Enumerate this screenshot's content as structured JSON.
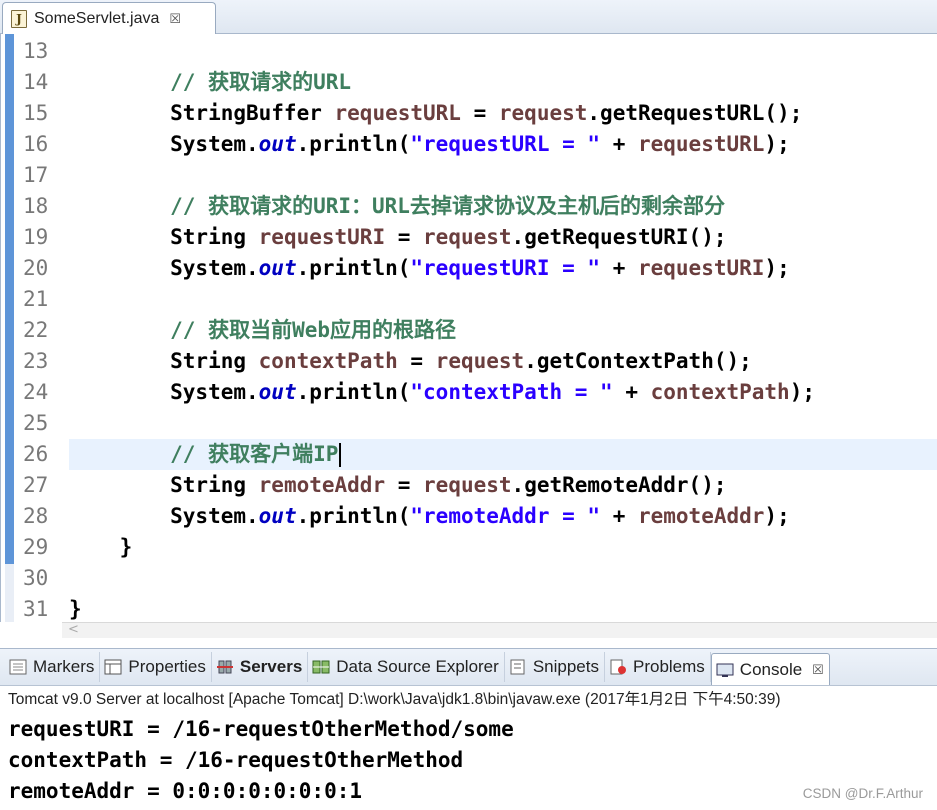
{
  "editor_tab": {
    "title": "SomeServlet.java",
    "icon": "java-file-icon",
    "icon_letter": "J",
    "close": "☒"
  },
  "code": {
    "lines": [
      {
        "n": "13",
        "tokens": []
      },
      {
        "n": "14",
        "tokens": [
          {
            "t": "        ",
            "c": "plain"
          },
          {
            "t": "// 获取请求的URL",
            "c": "comment"
          }
        ]
      },
      {
        "n": "15",
        "tokens": [
          {
            "t": "        StringBuffer ",
            "c": "plain"
          },
          {
            "t": "requestURL",
            "c": "var"
          },
          {
            "t": " = ",
            "c": "plain"
          },
          {
            "t": "request",
            "c": "var"
          },
          {
            "t": ".getRequestURL();",
            "c": "plain"
          }
        ]
      },
      {
        "n": "16",
        "tokens": [
          {
            "t": "        System.",
            "c": "plain"
          },
          {
            "t": "out",
            "c": "field"
          },
          {
            "t": ".println(",
            "c": "plain"
          },
          {
            "t": "\"requestURL = \"",
            "c": "string"
          },
          {
            "t": " + ",
            "c": "plain"
          },
          {
            "t": "requestURL",
            "c": "var"
          },
          {
            "t": ");",
            "c": "plain"
          }
        ]
      },
      {
        "n": "17",
        "tokens": []
      },
      {
        "n": "18",
        "tokens": [
          {
            "t": "        ",
            "c": "plain"
          },
          {
            "t": "// 获取请求的URI：URL去掉请求协议及主机后的剩余部分",
            "c": "comment"
          }
        ]
      },
      {
        "n": "19",
        "tokens": [
          {
            "t": "        String ",
            "c": "plain"
          },
          {
            "t": "requestURI",
            "c": "var"
          },
          {
            "t": " = ",
            "c": "plain"
          },
          {
            "t": "request",
            "c": "var"
          },
          {
            "t": ".getRequestURI();",
            "c": "plain"
          }
        ]
      },
      {
        "n": "20",
        "tokens": [
          {
            "t": "        System.",
            "c": "plain"
          },
          {
            "t": "out",
            "c": "field"
          },
          {
            "t": ".println(",
            "c": "plain"
          },
          {
            "t": "\"requestURI = \"",
            "c": "string"
          },
          {
            "t": " + ",
            "c": "plain"
          },
          {
            "t": "requestURI",
            "c": "var"
          },
          {
            "t": ");",
            "c": "plain"
          }
        ]
      },
      {
        "n": "21",
        "tokens": []
      },
      {
        "n": "22",
        "tokens": [
          {
            "t": "        ",
            "c": "plain"
          },
          {
            "t": "// 获取当前Web应用的根路径",
            "c": "comment"
          }
        ]
      },
      {
        "n": "23",
        "tokens": [
          {
            "t": "        String ",
            "c": "plain"
          },
          {
            "t": "contextPath",
            "c": "var"
          },
          {
            "t": " = ",
            "c": "plain"
          },
          {
            "t": "request",
            "c": "var"
          },
          {
            "t": ".getContextPath();",
            "c": "plain"
          }
        ]
      },
      {
        "n": "24",
        "tokens": [
          {
            "t": "        System.",
            "c": "plain"
          },
          {
            "t": "out",
            "c": "field"
          },
          {
            "t": ".println(",
            "c": "plain"
          },
          {
            "t": "\"contextPath = \"",
            "c": "string"
          },
          {
            "t": " + ",
            "c": "plain"
          },
          {
            "t": "contextPath",
            "c": "var"
          },
          {
            "t": ");",
            "c": "plain"
          }
        ]
      },
      {
        "n": "25",
        "tokens": []
      },
      {
        "n": "26",
        "current": true,
        "tokens": [
          {
            "t": "        ",
            "c": "plain"
          },
          {
            "t": "// 获取客户端IP",
            "c": "comment"
          }
        ]
      },
      {
        "n": "27",
        "tokens": [
          {
            "t": "        String ",
            "c": "plain"
          },
          {
            "t": "remoteAddr",
            "c": "var"
          },
          {
            "t": " = ",
            "c": "plain"
          },
          {
            "t": "request",
            "c": "var"
          },
          {
            "t": ".getRemoteAddr();",
            "c": "plain"
          }
        ]
      },
      {
        "n": "28",
        "tokens": [
          {
            "t": "        System.",
            "c": "plain"
          },
          {
            "t": "out",
            "c": "field"
          },
          {
            "t": ".println(",
            "c": "plain"
          },
          {
            "t": "\"remoteAddr = \"",
            "c": "string"
          },
          {
            "t": " + ",
            "c": "plain"
          },
          {
            "t": "remoteAddr",
            "c": "var"
          },
          {
            "t": ");",
            "c": "plain"
          }
        ]
      },
      {
        "n": "29",
        "tokens": [
          {
            "t": "    }",
            "c": "plain"
          }
        ]
      },
      {
        "n": "30",
        "tokens": []
      },
      {
        "n": "31",
        "tokens": [
          {
            "t": "}",
            "c": "plain"
          }
        ]
      }
    ]
  },
  "views": {
    "tabs": [
      {
        "label": "Markers",
        "icon": "markers-icon"
      },
      {
        "label": "Properties",
        "icon": "properties-icon"
      },
      {
        "label": "Servers",
        "icon": "servers-icon",
        "bold": true
      },
      {
        "label": "Data Source Explorer",
        "icon": "data-source-icon"
      },
      {
        "label": "Snippets",
        "icon": "snippets-icon"
      },
      {
        "label": "Problems",
        "icon": "problems-icon"
      },
      {
        "label": "Console",
        "icon": "console-icon",
        "active": true,
        "close": "☒"
      }
    ]
  },
  "console": {
    "header": "Tomcat v9.0 Server at localhost [Apache Tomcat] D:\\work\\Java\\jdk1.8\\bin\\javaw.exe (2017年1月2日 下午4:50:39)",
    "output": [
      "requestURI = /16-requestOtherMethod/some",
      "contextPath = /16-requestOtherMethod",
      "remoteAddr = 0:0:0:0:0:0:0:1"
    ]
  },
  "watermark": "CSDN @Dr.F.Arthur",
  "colors": {
    "comment": "#3f7f5f",
    "variable": "#6a3e3e",
    "field": "#0000c0",
    "string": "#2a00ff",
    "current_line": "#e8f2fe",
    "gutter_marker": "#5e95d8"
  }
}
